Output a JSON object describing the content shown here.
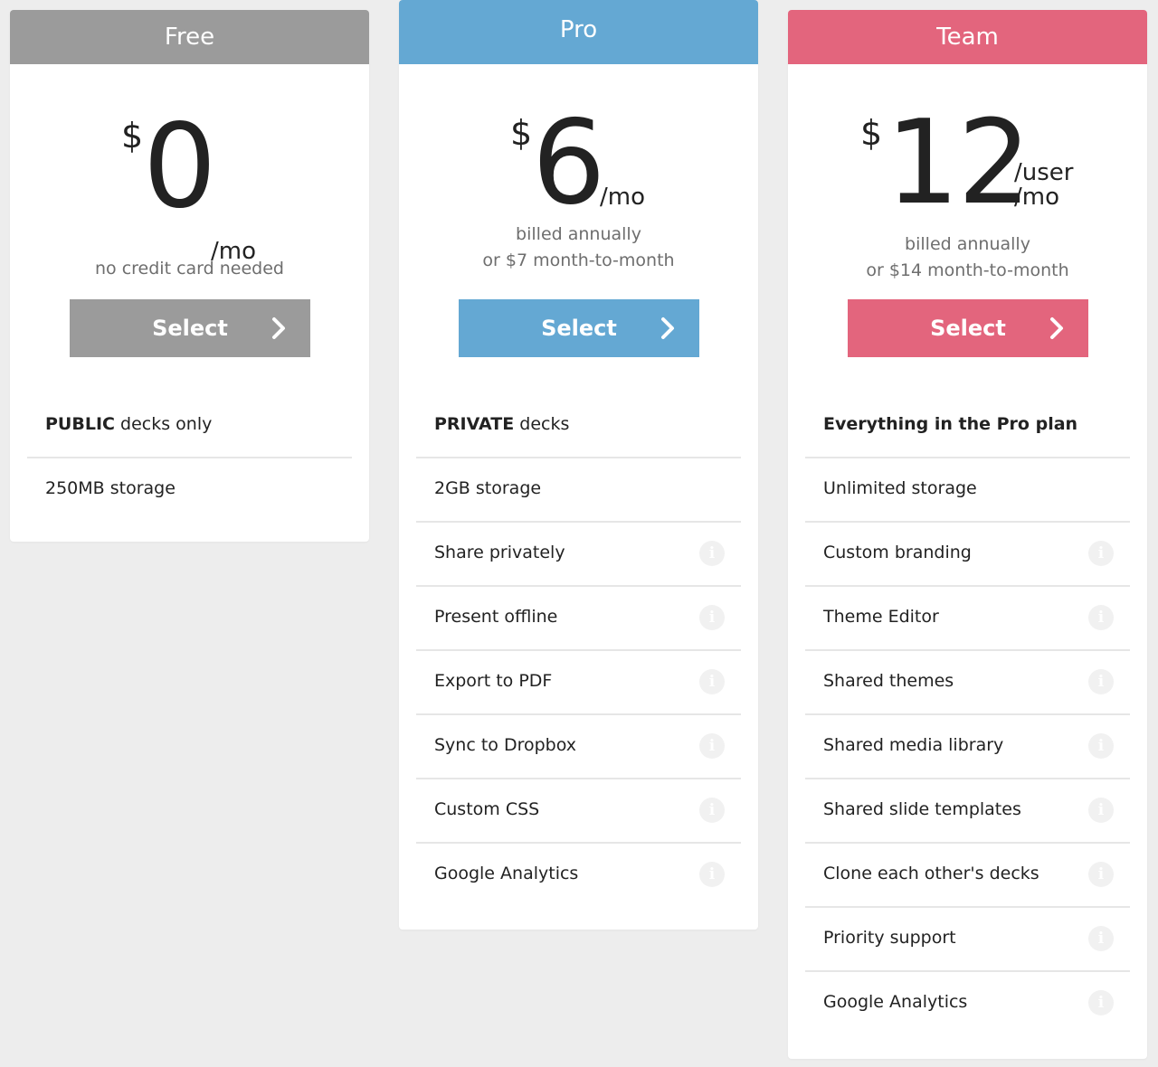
{
  "colors": {
    "free": "#9b9b9b",
    "pro": "#64a8d3",
    "team": "#e3657d"
  },
  "plans": {
    "free": {
      "name": "Free",
      "currency": "$",
      "amount": "0",
      "period": "/mo",
      "note1": "no credit card needed",
      "button": "Select",
      "features": [
        {
          "bold": "PUBLIC",
          "text": " decks only"
        },
        {
          "bold": "",
          "text": "250MB storage"
        }
      ]
    },
    "pro": {
      "name": "Pro",
      "currency": "$",
      "amount": "6",
      "period": "/mo",
      "note1": "billed annually",
      "note2": "or $7 month-to-month",
      "button": "Select",
      "features": [
        {
          "bold": "PRIVATE",
          "text": " decks"
        },
        {
          "bold": "",
          "text": "2GB storage"
        },
        {
          "bold": "",
          "text": "Share privately"
        },
        {
          "bold": "",
          "text": "Present offline"
        },
        {
          "bold": "",
          "text": "Export to PDF"
        },
        {
          "bold": "",
          "text": "Sync to Dropbox"
        },
        {
          "bold": "",
          "text": "Custom CSS"
        },
        {
          "bold": "",
          "text": "Google Analytics"
        }
      ]
    },
    "team": {
      "name": "Team",
      "currency": "$",
      "amount": "12",
      "period_line1": "/user",
      "period_line2": "/mo",
      "note1": "billed annually",
      "note2": "or $14 month-to-month",
      "button": "Select",
      "features": [
        {
          "bold": "Everything in the Pro plan",
          "text": ""
        },
        {
          "bold": "",
          "text": "Unlimited storage"
        },
        {
          "bold": "",
          "text": "Custom branding"
        },
        {
          "bold": "",
          "text": "Theme Editor"
        },
        {
          "bold": "",
          "text": "Shared themes"
        },
        {
          "bold": "",
          "text": "Shared media library"
        },
        {
          "bold": "",
          "text": "Shared slide templates"
        },
        {
          "bold": "",
          "text": "Clone each other's decks"
        },
        {
          "bold": "",
          "text": "Priority support"
        },
        {
          "bold": "",
          "text": "Google Analytics"
        }
      ]
    }
  },
  "info_icon_glyph": "i"
}
